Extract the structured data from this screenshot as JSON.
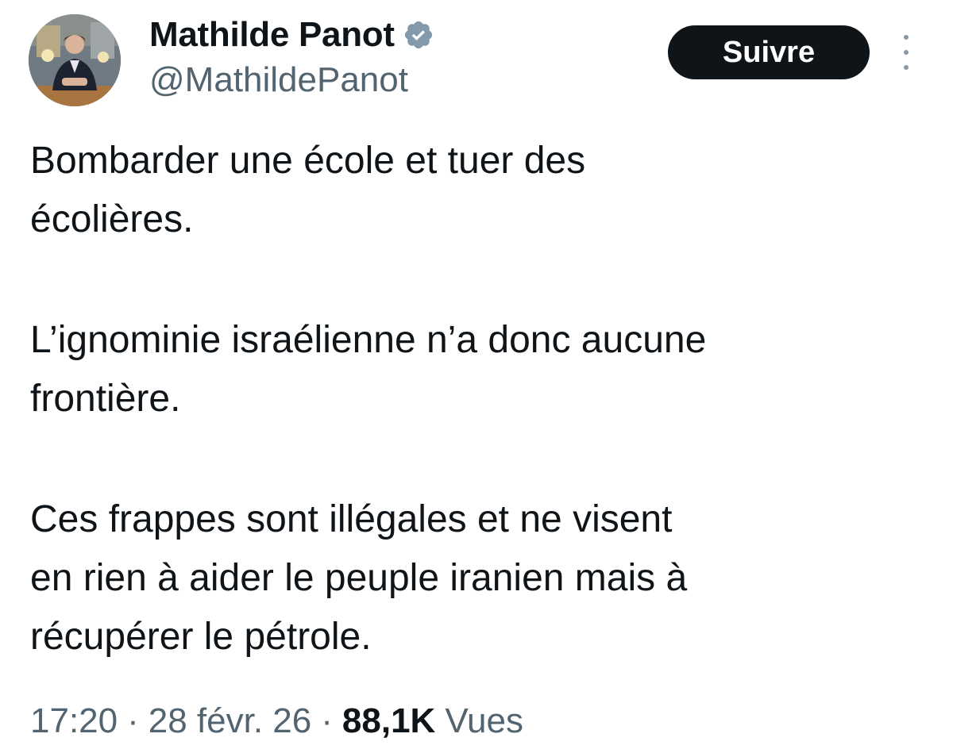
{
  "author": {
    "display_name": "Mathilde Panot",
    "handle": "@MathildePanot",
    "verified_icon": "verified-badge-icon",
    "verified_color": "#829aab"
  },
  "actions": {
    "follow_label": "Suivre",
    "more_icon": "more-options-icon"
  },
  "tweet": {
    "paragraphs": [
      "Bombarder une école et tuer des\nécolières.",
      "L’ignominie israélienne n’a donc aucune\nfrontière.",
      "Ces frappes sont illégales et ne visent\nen rien à aider le peuple iranien mais à\nrécupérer le pétrole."
    ]
  },
  "meta": {
    "time": "17:20",
    "separator": "·",
    "date": "28 févr. 26",
    "views_count": "88,1K",
    "views_label": "Vues"
  },
  "colors": {
    "text_primary": "#0f1419",
    "text_secondary": "#536471",
    "button_bg": "#0f1419",
    "button_text": "#ffffff"
  }
}
